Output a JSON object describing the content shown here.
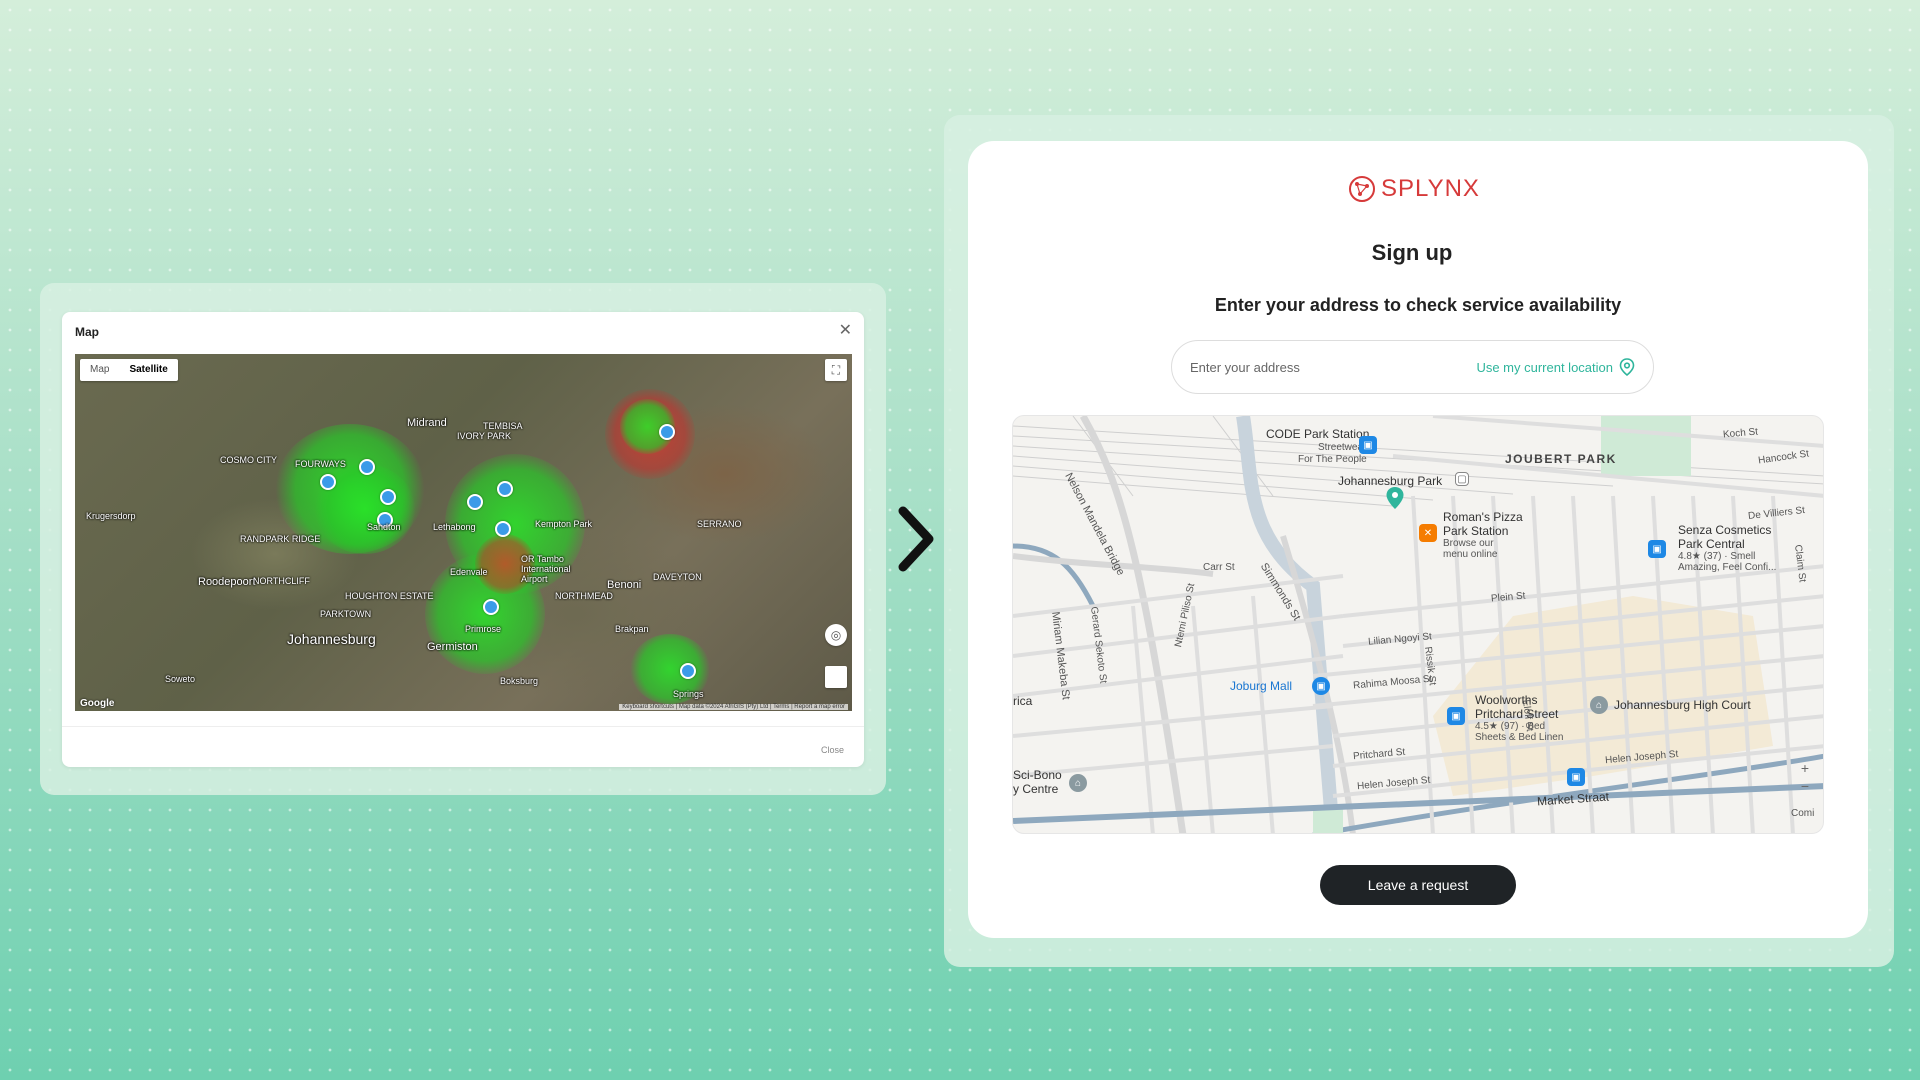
{
  "map_dialog": {
    "title": "Map",
    "close_icon": "close-icon",
    "toggle": {
      "map": "Map",
      "satellite": "Satellite",
      "active": "Satellite"
    },
    "labels": {
      "johannesburg": "Johannesburg",
      "roodepoort": "Roodepoort",
      "krugersdorp": "Krugersdorp",
      "midrand": "Midrand",
      "benoni": "Benoni",
      "germiston": "Germiston",
      "boksburg": "Boksburg",
      "springs": "Springs",
      "soweto": "Soweto",
      "airport": "OR Tambo International Airport",
      "randpark": "RANDPARK RIDGE",
      "northcliff": "NORTHCLIFF",
      "parktown": "PARKTOWN",
      "houghton": "HOUGHTON ESTATE",
      "northmead": "NORTHMEAD",
      "daveyton": "DAVEYTON",
      "tembisa": "TEMBISA",
      "ivory_park": "IVORY PARK",
      "cosmo": "COSMO CITY",
      "fourways": "FOURWAYS",
      "serrano": "SERRANO",
      "kempton": "Kempton Park",
      "edenvale": "Edenvale",
      "sandton": "Sandton",
      "lethabong": "Lethabong",
      "brakpan": "Brakpan",
      "primrose": "Primrose",
      "google": "Google",
      "attribution": "Keyboard shortcuts | Map data ©2024 AfriGIS (Pty) Ltd | Terms | Report a map error"
    },
    "footer_close": "Close"
  },
  "signup": {
    "logo_text": "SPLYNX",
    "title": "Sign up",
    "subtitle": "Enter your address to check service availability",
    "address_placeholder": "Enter your address",
    "location_link": "Use my current location",
    "button": "Leave a request"
  },
  "street_map": {
    "labels": {
      "code_park": "CODE Park Station",
      "streetwear": "Streetwear",
      "for_the_people": "For The People",
      "joubert_park": "JOUBERT PARK",
      "jhb_park": "Johannesburg Park",
      "romans_1": "Roman's Pizza",
      "romans_2": "Park Station",
      "browse_1": "Browse our",
      "browse_2": "menu online",
      "senza_1": "Senza Cosmetics",
      "senza_2": "Park Central",
      "senza_3": "4.8★ (37) · Smell",
      "senza_4": "Amazing, Feel Confi...",
      "joburg_mall": "Joburg Mall",
      "woolworths_1": "Woolworths",
      "woolworths_2": "Pritchard Street",
      "woolworths_3": "4.5★ (97) · Bed",
      "woolworths_4": "Sheets & Bed Linen",
      "high_court": "Johannesburg High Court",
      "scibono_1": "Sci-Bono",
      "scibono_2": "y Centre",
      "rica": "rica",
      "nelson": "Nelson Mandela Bridge",
      "miriam": "Miriam Makeba St",
      "gerard": "Gerard Sekoto St",
      "ntemi": "Ntemi Piliso St",
      "carr": "Carr St",
      "simmonds": "Simmonds St",
      "plein": "Plein St",
      "lilian": "Lilian Ngoyi St",
      "rahima": "Rahima Moosa St",
      "pritchard": "Pritchard St",
      "helen1": "Helen Joseph St",
      "helen2": "Helen Joseph St",
      "market": "Market Straat",
      "rissik": "Rissik St",
      "eloff": "Eloff St",
      "koch": "Koch St",
      "hancock": "Hancock St",
      "devilliers": "De Villiers St",
      "claim": "Claim St",
      "comi": "Comi"
    }
  },
  "colors": {
    "brand": "#d63a3a",
    "accent": "#2fb59c",
    "button": "#1f2326"
  }
}
